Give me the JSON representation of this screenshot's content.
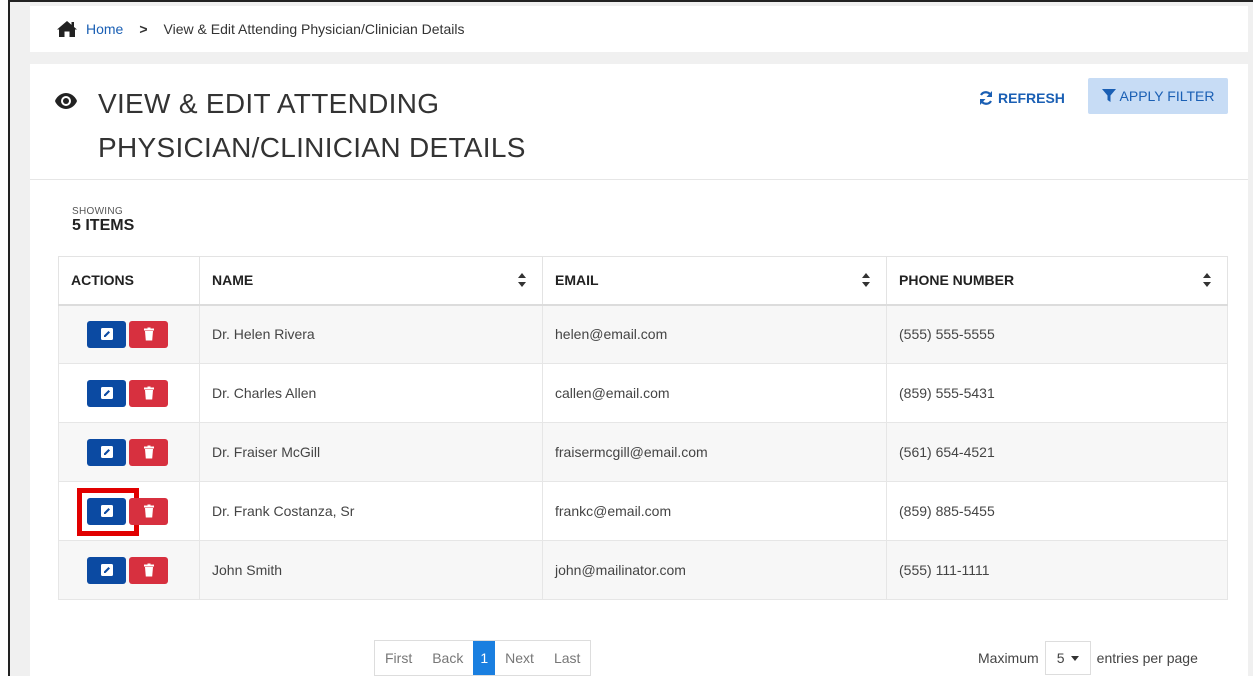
{
  "breadcrumb": {
    "home_label": "Home",
    "separator": ">",
    "current": "View & Edit Attending Physician/Clinician Details"
  },
  "header": {
    "title_line1": "VIEW & EDIT ATTENDING",
    "title_line2": "PHYSICIAN/CLINICIAN DETAILS",
    "refresh_label": "REFRESH",
    "filter_label": "APPLY FILTER"
  },
  "summary": {
    "showing_label": "SHOWING",
    "count_label": "5 ITEMS"
  },
  "table": {
    "columns": [
      "ACTIONS",
      "NAME",
      "EMAIL",
      "PHONE NUMBER"
    ],
    "rows": [
      {
        "name": "Dr. Helen Rivera",
        "email": "helen@email.com",
        "phone": "(555) 555-5555"
      },
      {
        "name": "Dr. Charles Allen",
        "email": "callen@email.com",
        "phone": "(859) 555-5431"
      },
      {
        "name": "Dr. Fraiser McGill",
        "email": "fraisermcgill@email.com",
        "phone": "(561) 654-4521"
      },
      {
        "name": "Dr. Frank Costanza, Sr",
        "email": "frankc@email.com",
        "phone": "(859) 885-5455"
      },
      {
        "name": "John Smith",
        "email": "john@mailinator.com",
        "phone": "(555) 111-1111"
      }
    ]
  },
  "pagination": {
    "first": "First",
    "back": "Back",
    "current_page": "1",
    "next": "Next",
    "last": "Last"
  },
  "per_page": {
    "prefix": "Maximum",
    "value": "5",
    "suffix": "entries per page"
  },
  "colors": {
    "edit_button": "#0b4aa2",
    "delete_button": "#d7303f",
    "accent": "#1a5fb4",
    "highlight": "#e10000"
  }
}
